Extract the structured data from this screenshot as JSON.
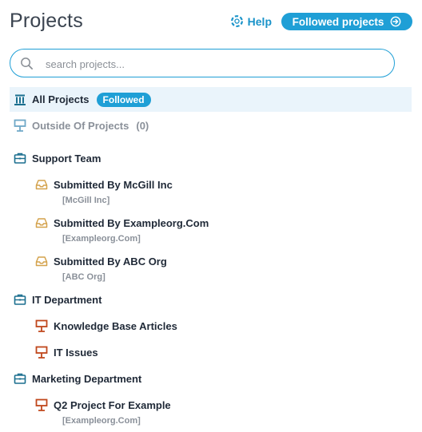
{
  "header": {
    "title": "Projects",
    "help_label": "Help",
    "followed_button": "Followed projects"
  },
  "search": {
    "placeholder": "search projects..."
  },
  "all_projects": {
    "label": "All Projects",
    "badge": "Followed"
  },
  "outside": {
    "label": "Outside Of Projects",
    "count": "(0)"
  },
  "groups": [
    {
      "label": "Support Team",
      "items": [
        {
          "label": "Submitted By McGill Inc",
          "sub": "[McGill Inc]"
        },
        {
          "label": "Submitted By Exampleorg.Com",
          "sub": "[Exampleorg.Com]"
        },
        {
          "label": "Submitted By ABC Org",
          "sub": "[ABC Org]"
        }
      ]
    },
    {
      "label": "IT Department",
      "items": [
        {
          "label": "Knowledge Base Articles"
        },
        {
          "label": "IT Issues"
        }
      ]
    },
    {
      "label": "Marketing Department",
      "items": [
        {
          "label": "Q2 Project For Example",
          "sub": "[Exampleorg.Com]"
        }
      ]
    }
  ],
  "colors": {
    "accent": "#1f9fd6",
    "team_icon": "#1b6f8f",
    "inbox_icon": "#d4a24c",
    "project_icon": "#c0471c"
  }
}
